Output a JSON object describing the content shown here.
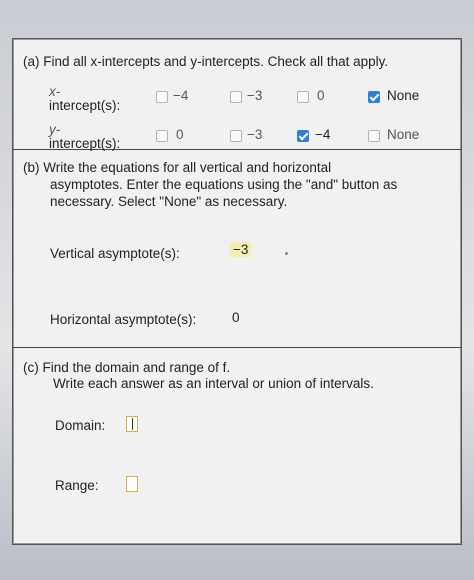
{
  "part_a": {
    "prompt": "(a) Find all x-intercepts and y-intercepts. Check all that apply.",
    "x_row": {
      "label_top": "x-",
      "label_bottom": "intercept(s):",
      "options": [
        {
          "label": "−4",
          "checked": false
        },
        {
          "label": "−3",
          "checked": false
        },
        {
          "label": "0",
          "checked": false
        },
        {
          "label": "None",
          "checked": true
        }
      ]
    },
    "y_row": {
      "label_top": "y-",
      "label_bottom": "intercept(s):",
      "options": [
        {
          "label": "0",
          "checked": false
        },
        {
          "label": "−3",
          "checked": false
        },
        {
          "label": "−4",
          "checked": true
        },
        {
          "label": "None",
          "checked": false
        }
      ]
    }
  },
  "part_b": {
    "prompt_line1": "(b) Write the equations for all vertical and horizontal",
    "prompt_line2": "asymptotes. Enter the equations using the \"and\" button as",
    "prompt_line3": "necessary. Select \"None\" as necessary.",
    "vertical_label": "Vertical asymptote(s):",
    "vertical_value": "−3",
    "horizontal_label": "Horizontal asymptote(s):",
    "horizontal_value": "0"
  },
  "part_c": {
    "prompt_line1": "(c) Find the domain and range of f.",
    "prompt_line2": "Write each answer as an interval or union of intervals.",
    "domain_label": "Domain:",
    "range_label": "Range:"
  },
  "colors": {
    "checkbox_checked": "#2f7fd6",
    "answer_highlight": "#f3efb0",
    "input_border": "#d0b24a"
  }
}
